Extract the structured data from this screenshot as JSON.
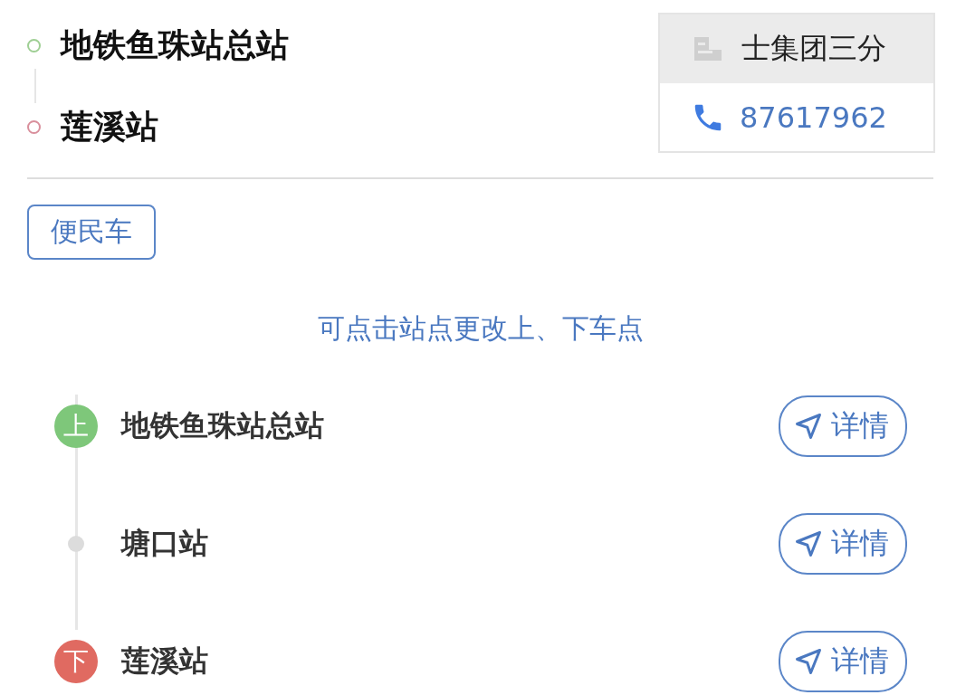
{
  "route": {
    "origin": "地铁鱼珠站总站",
    "destination": "莲溪站"
  },
  "company_card": {
    "name": "士集团三分",
    "phone": "87617962"
  },
  "tag": "便民车",
  "hint": "可点击站点更改上、下车点",
  "stops": [
    {
      "kind": "board",
      "marker": "上",
      "name": "地铁鱼珠站总站",
      "action": "详情"
    },
    {
      "kind": "pass",
      "name": "塘口站",
      "action": "详情"
    },
    {
      "kind": "alight",
      "marker": "下",
      "name": "莲溪站",
      "action": "详情"
    }
  ]
}
